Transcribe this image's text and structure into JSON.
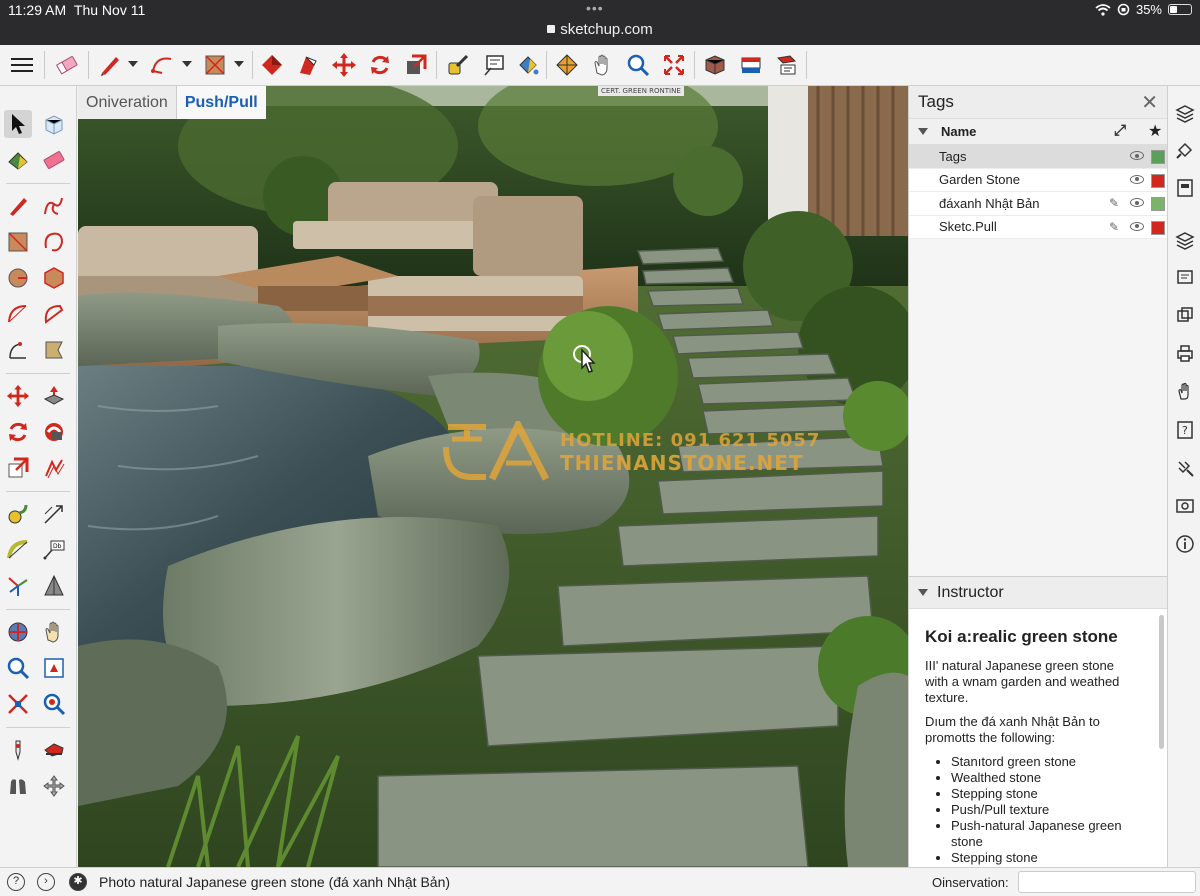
{
  "status_bar": {
    "time": "11:29 AM",
    "date": "Thu Nov 11",
    "url": "sketchup.com",
    "battery": "35%",
    "battery_level": 0.35
  },
  "mode_tabs": [
    {
      "label": "Oniveration",
      "active": false
    },
    {
      "label": "Push/Pull",
      "active": true
    }
  ],
  "viewport": {
    "badge": "CERT. GREEN RONTINE",
    "watermark_line1": "HOTLINE: 091 621 5057",
    "watermark_line2": "THIENANSTONE.NET"
  },
  "tags_panel": {
    "title": "Tags",
    "column_name": "Name",
    "rows": [
      {
        "label": "Tags",
        "color": "#5aa05a",
        "selected": true,
        "edit": false
      },
      {
        "label": "Garden Stone",
        "color": "#d0281e",
        "selected": false,
        "edit": false
      },
      {
        "label": "đáxanh Nhật Bản",
        "color": "#7bb36b",
        "selected": false,
        "edit": true
      },
      {
        "label": "Sketc.Pull",
        "color": "#d0281e",
        "selected": false,
        "edit": true
      }
    ]
  },
  "instructor": {
    "title": "Instructor",
    "heading": "Koi a:realic green stone",
    "para1": "III' natural Japanese green stone with a wnam garden and weathed texture.",
    "para2": "Dıum the đá xanh Nhật Bản to promotts the following:",
    "items": [
      "Stanıtord green stone",
      "Wealthed stone",
      "Stepping stone",
      "Push/Pull texture",
      "Push-natural Japanese green stone",
      "Stepping stone"
    ]
  },
  "bottom_bar": {
    "status": "Photo natural Japanese green stone (đá xanh Nhật Bản)",
    "observation_label": "Oinservation:",
    "observation_value": ""
  },
  "colors": {
    "accent": "#1a5fb4",
    "tool_red": "#d0281e",
    "watermark": "#e0a53a"
  }
}
